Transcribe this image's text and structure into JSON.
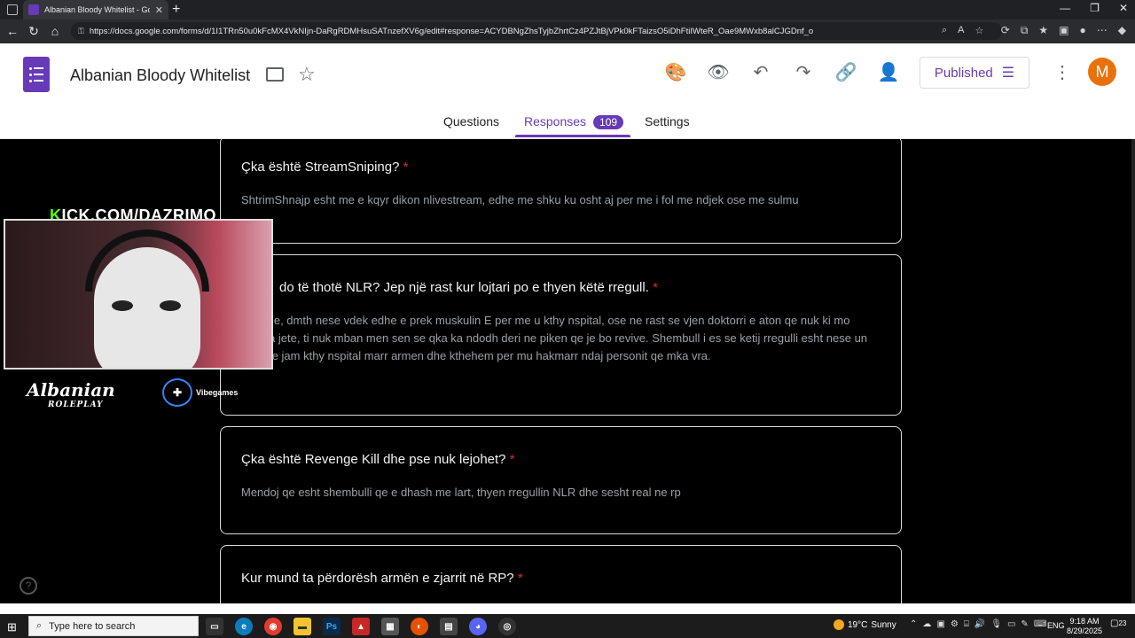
{
  "browser": {
    "tab_title": "Albanian Bloody Whitelist - Goog",
    "url": "https://docs.google.com/forms/d/1I1TRn50u0kFcMX4VkNIjn-DaRgRDMHsuSATnzefXV6g/edit#response=ACYDBNgZhsTyjbZhrtCz4PZJtBjVPk0kFTaizsO5iDhFtiIWteR_Oae9MWxb8alCJGDnf_o"
  },
  "header": {
    "form_title": "Albanian Bloody Whitelist",
    "published_label": "Published",
    "avatar_initial": "M"
  },
  "tabs": {
    "questions": "Questions",
    "responses": "Responses",
    "responses_count": "109",
    "settings": "Settings"
  },
  "cards": [
    {
      "question": "Çka është StreamSniping?",
      "required_mark": "*",
      "answer": "ShtrimShnajp esht me e kqyr dikon nlivestream, edhe me shku ku osht aj per me i fol me ndjek ose me sulmu"
    },
    {
      "question": "do të thotë NLR? Jep një rast kur lojtari po e thyen këtë rregull.",
      "required_mark": "*",
      "answer": "ife Rule, dmth nese vdek edhe e prek muskulin E per me u kthy nspital, ose ne rast se vjen doktorri e aton qe nuk ki mo shenja jete, ti nuk mban men sen se qka ka ndodh deri ne piken qe je bo revive. Shembull i es se ketij rregulli esht nese un pasi qe jam kthy nspital marr armen dhe kthehem per mu hakmarr ndaj personit qe mka vra."
    },
    {
      "question": "Çka është Revenge Kill dhe pse nuk lejohet?",
      "required_mark": "*",
      "answer": "Mendoj qe esht shembulli qe e dhash me lart, thyen rregullin NLR dhe sesht real ne rp"
    },
    {
      "question": "Kur mund ta përdorësh armën e zjarrit në RP?",
      "required_mark": "*",
      "answer": ""
    }
  ],
  "overlay": {
    "kick_k": "K",
    "kick_rest": "ICK.COM/DAZRIMO",
    "roleplay_logo_text": "Albanian",
    "roleplay_sub": "ROLEPLAY",
    "vibe_label": "Vibegames"
  },
  "taskbar": {
    "search_placeholder": "Type here to search",
    "weather_temp": "19°C",
    "weather_desc": "Sunny",
    "lang": "ENG",
    "time": "9:18 AM",
    "date": "8/29/2025",
    "notif_count": "23"
  }
}
